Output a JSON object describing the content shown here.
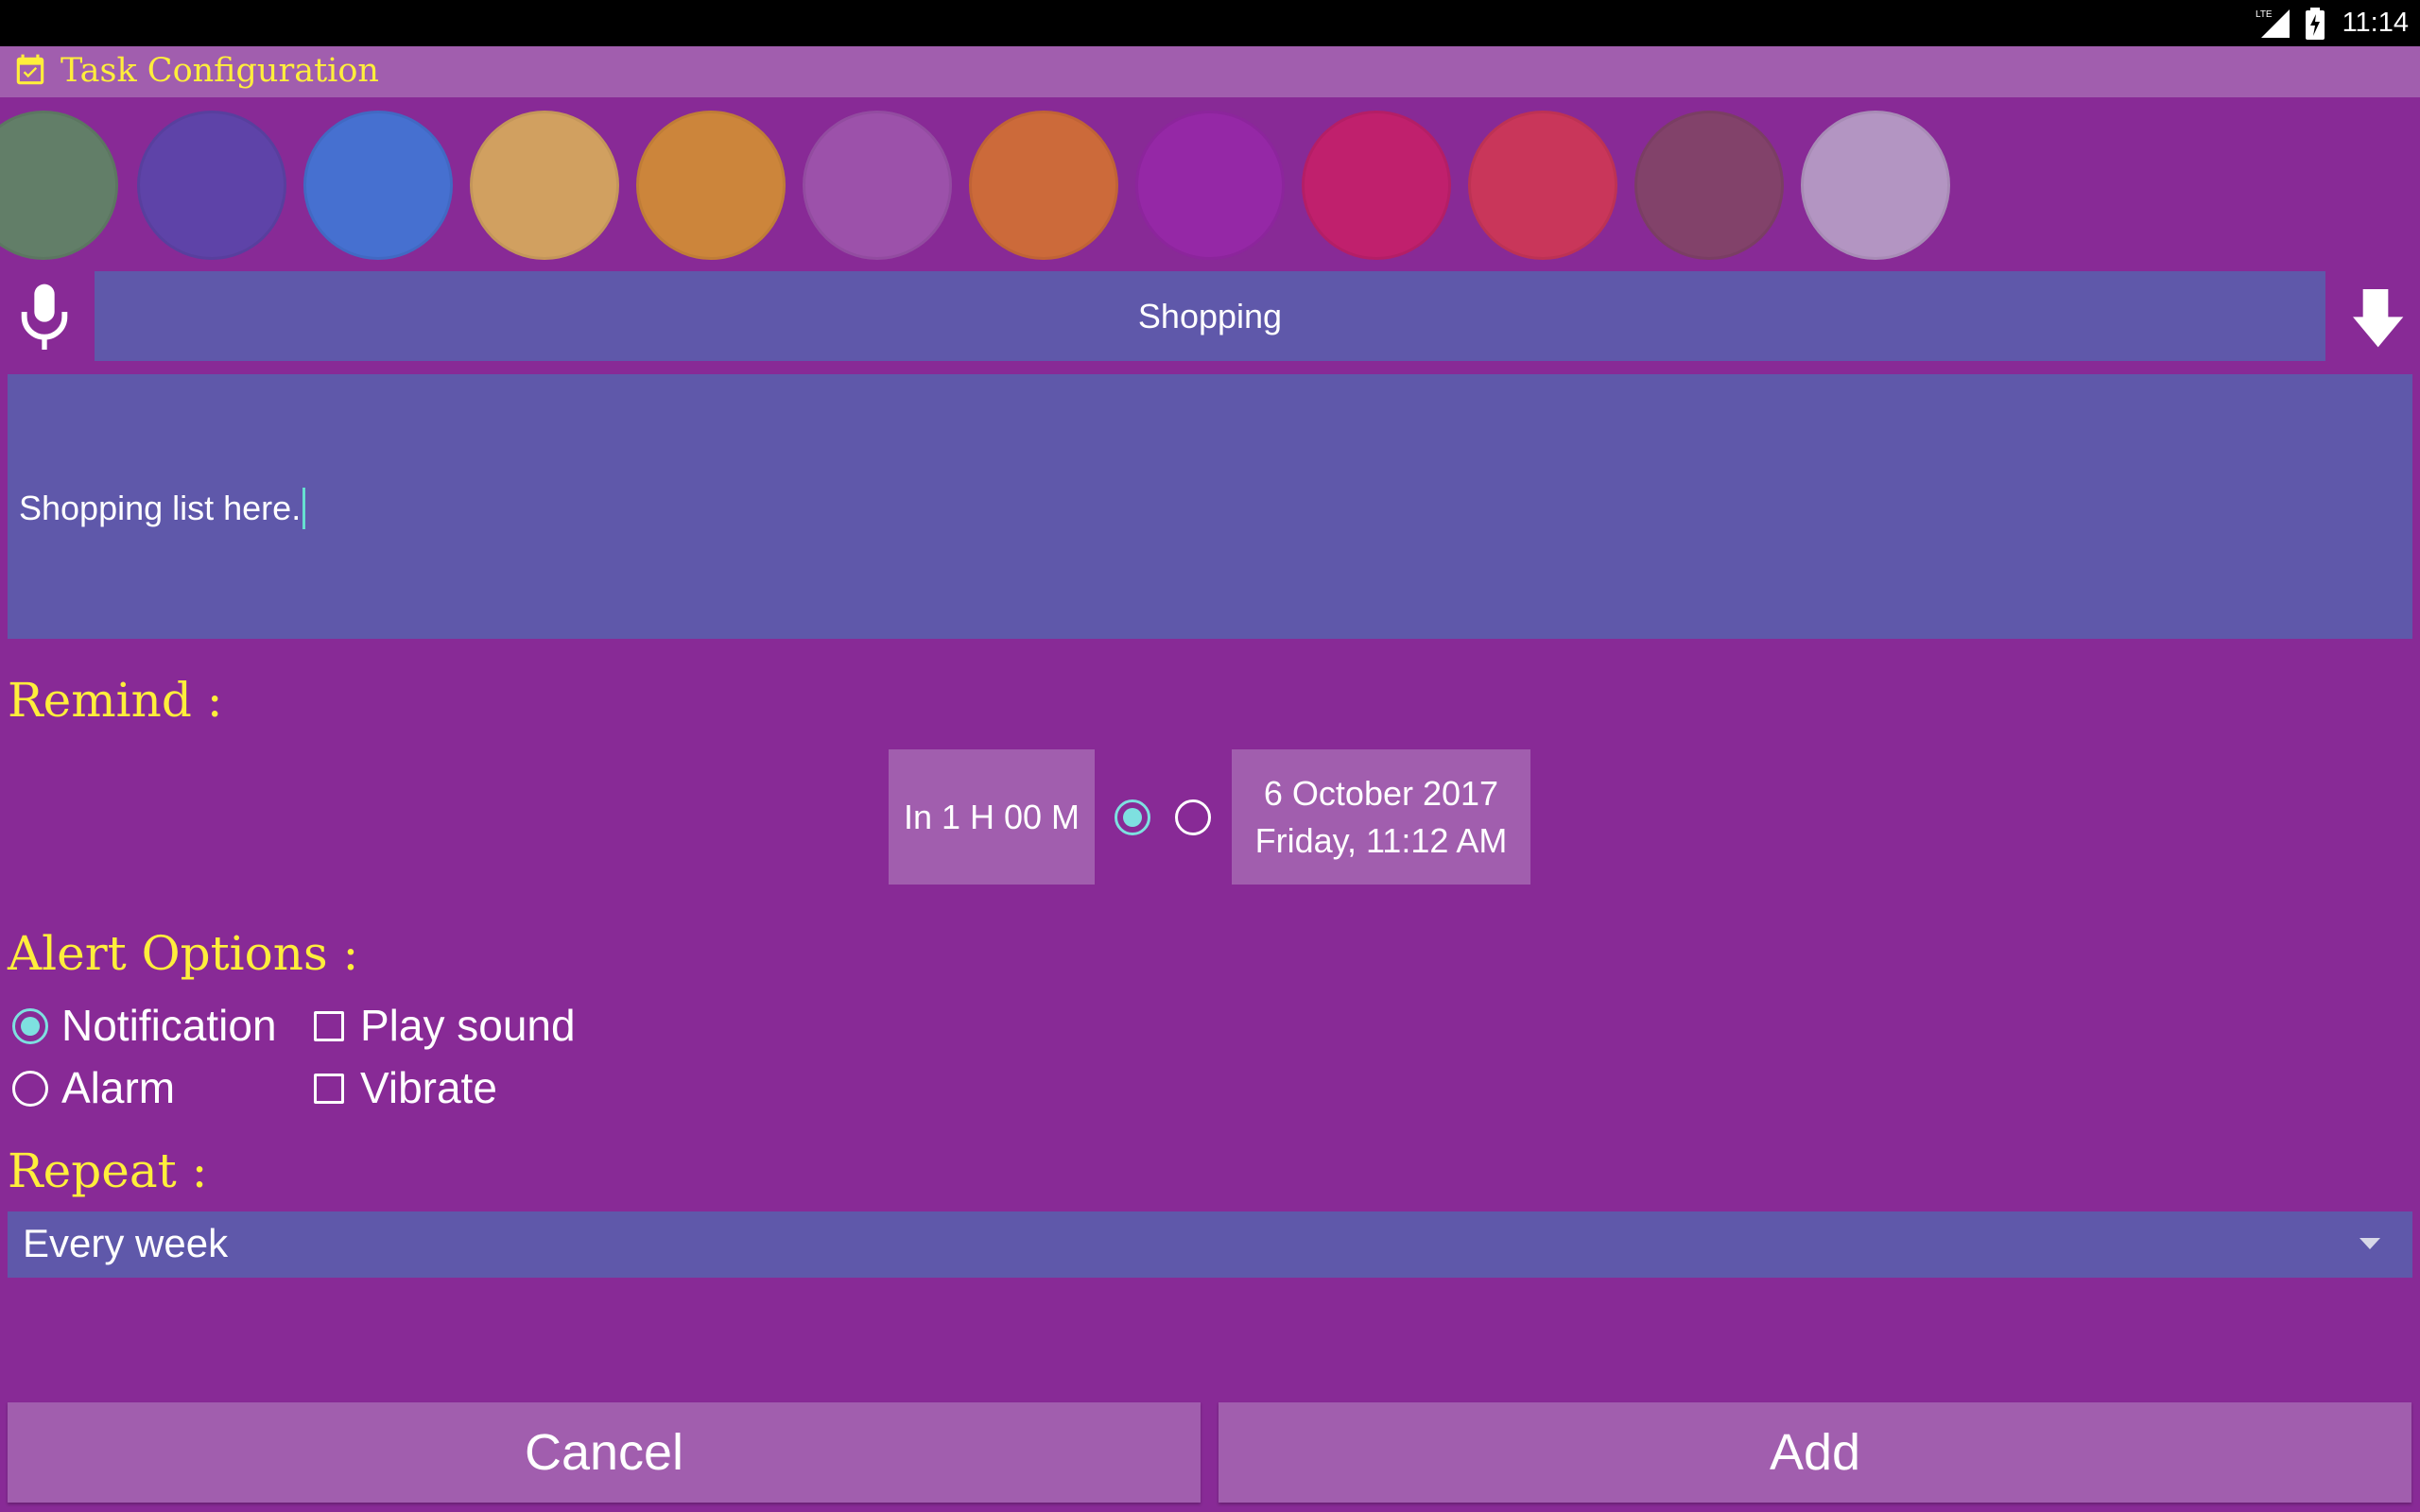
{
  "status_bar": {
    "network": "LTE",
    "time": "11:14"
  },
  "title_bar": {
    "icon": "calendar-check-icon",
    "title": "Task Configuration"
  },
  "colors": [
    "#627e68",
    "#5e43a8",
    "#4670d0",
    "#d1a060",
    "#cc853b",
    "#9c51aa",
    "#cc6a3a",
    "#9528a6",
    "#c0206d",
    "#c9365a",
    "#82426a",
    "#b395c2"
  ],
  "task": {
    "title": "Shopping",
    "mic_icon": "microphone-icon",
    "action_icon": "arrow-down-turn-icon",
    "note": "Shopping list here."
  },
  "remind": {
    "label": "Remind :",
    "relative_label": "In 1 H 00 M",
    "absolute_line1": "6 October 2017",
    "absolute_line2": "Friday, 11:12 AM",
    "selected": "relative"
  },
  "alert": {
    "label": "Alert Options :",
    "notification": "Notification",
    "alarm": "Alarm",
    "play_sound": "Play sound",
    "vibrate": "Vibrate",
    "selected": "notification",
    "play_sound_checked": false,
    "vibrate_checked": false
  },
  "repeat": {
    "label": "Repeat :",
    "value": "Every week"
  },
  "buttons": {
    "cancel": "Cancel",
    "add": "Add"
  }
}
